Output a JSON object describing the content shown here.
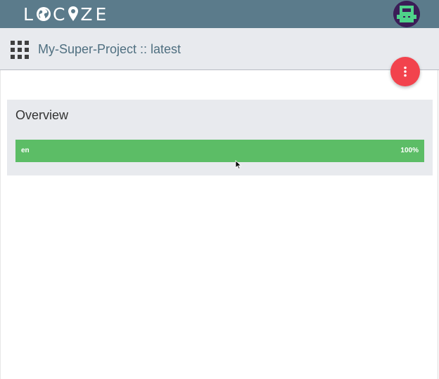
{
  "app": {
    "logo_text": "LOCIZE",
    "logo_letters": [
      "L",
      "O",
      "C",
      "I",
      "Z",
      "E"
    ]
  },
  "header": {
    "project_title": "My-Super-Project :: latest"
  },
  "overview": {
    "title": "Overview",
    "languages": [
      {
        "code": "en",
        "percent_label": "100%",
        "progress": 1.0
      }
    ]
  },
  "colors": {
    "topbar": "#5b7b8b",
    "accent_fab": "#f2434d",
    "progress_green": "#5cbd66",
    "card_background": "#e8eaee"
  },
  "icons": {
    "apps": "grid-icon",
    "fab": "more-vertical-icon",
    "avatar": "robot-avatar-icon",
    "logo_o": "globe-icon",
    "logo_i": "map-pin-icon"
  }
}
